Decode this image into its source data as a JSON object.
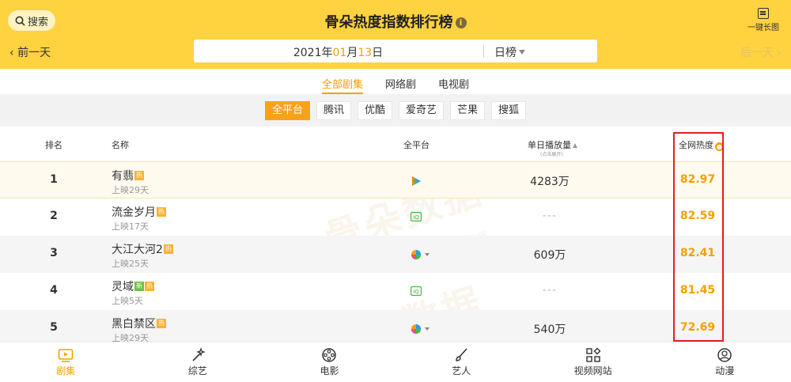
{
  "header": {
    "search_label": "搜索",
    "title": "骨朵热度指数排行榜",
    "long_image_label": "一键长图",
    "prev_day": "前一天",
    "next_day": "后一天",
    "date": {
      "year": "2021",
      "year_unit": "年",
      "month": "01",
      "month_unit": "月",
      "day": "13",
      "day_unit": "日"
    },
    "rank_type": "日榜"
  },
  "category_tabs": [
    {
      "label": "全部剧集",
      "active": true
    },
    {
      "label": "网络剧",
      "active": false
    },
    {
      "label": "电视剧",
      "active": false
    }
  ],
  "platforms": [
    {
      "label": "全平台",
      "active": true
    },
    {
      "label": "腾讯",
      "active": false
    },
    {
      "label": "优酷",
      "active": false
    },
    {
      "label": "爱奇艺",
      "active": false
    },
    {
      "label": "芒果",
      "active": false
    },
    {
      "label": "搜狐",
      "active": false
    }
  ],
  "table": {
    "headers": {
      "rank": "排名",
      "name": "名称",
      "platform": "全平台",
      "plays": "单日播放量",
      "plays_sub": "(点击展开)",
      "heat": "全网热度"
    },
    "rows": [
      {
        "rank": "1",
        "name": "有翡",
        "badges": [
          "热"
        ],
        "release": "上映29天",
        "platform": "tencent",
        "plays": "4283万",
        "heat": "82.97"
      },
      {
        "rank": "2",
        "name": "流金岁月",
        "badges": [
          "热"
        ],
        "release": "上映17天",
        "platform": "iqiyi",
        "plays": "---",
        "heat": "82.59"
      },
      {
        "rank": "3",
        "name": "大江大河2",
        "badges": [
          "热"
        ],
        "release": "上映25天",
        "platform": "multi",
        "plays": "609万",
        "heat": "82.41"
      },
      {
        "rank": "4",
        "name": "灵域",
        "badges": [
          "新",
          "热"
        ],
        "release": "上映5天",
        "platform": "iqiyi",
        "plays": "---",
        "heat": "81.45"
      },
      {
        "rank": "5",
        "name": "黑白禁区",
        "badges": [
          "热"
        ],
        "release": "上映29天",
        "platform": "multi",
        "plays": "540万",
        "heat": "72.69"
      }
    ]
  },
  "watermark": {
    "text": "骨朵数据",
    "sub": "骨朵娱乐数据"
  },
  "bottom_nav": [
    {
      "label": "剧集",
      "icon": "tv-icon",
      "active": true
    },
    {
      "label": "综艺",
      "icon": "magic-wand-icon",
      "active": false
    },
    {
      "label": "电影",
      "icon": "film-reel-icon",
      "active": false
    },
    {
      "label": "艺人",
      "icon": "brush-icon",
      "active": false
    },
    {
      "label": "视频网站",
      "icon": "grid-icon",
      "active": false
    },
    {
      "label": "动漫",
      "icon": "face-icon",
      "active": false
    }
  ]
}
